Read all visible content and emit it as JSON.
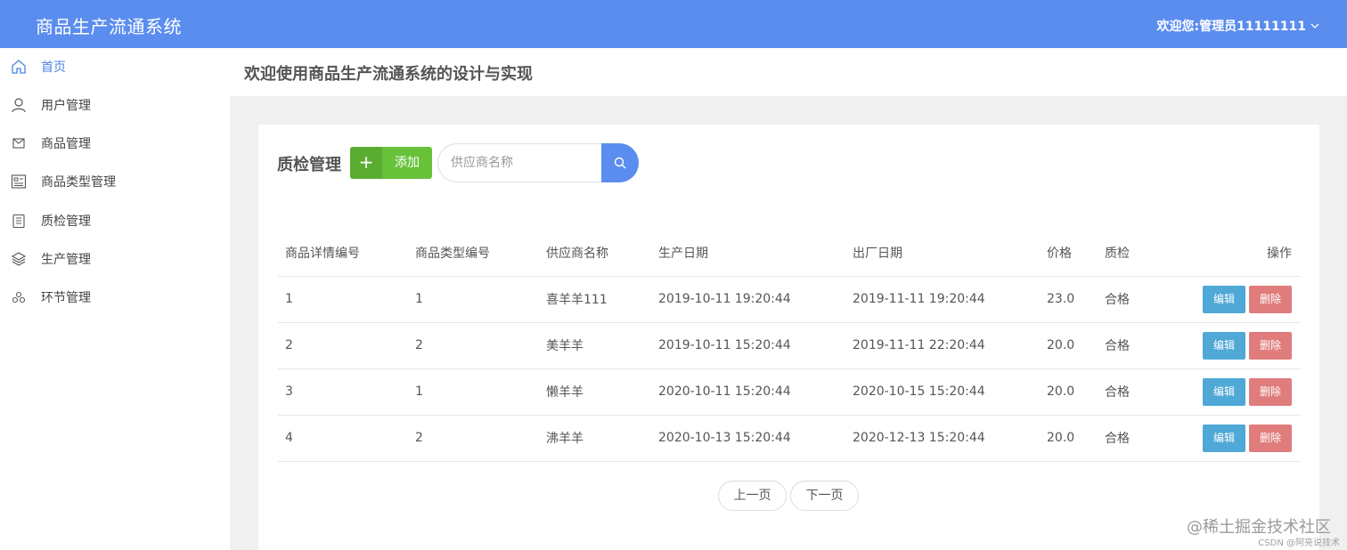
{
  "app": {
    "title": "商品生产流通系统",
    "user_greeting": "欢迎您:管理员11111111"
  },
  "sidebar": {
    "items": [
      {
        "label": "首页",
        "icon": "home-icon",
        "active": true
      },
      {
        "label": "用户管理",
        "icon": "user-icon"
      },
      {
        "label": "商品管理",
        "icon": "mail-icon"
      },
      {
        "label": "商品类型管理",
        "icon": "list-icon"
      },
      {
        "label": "质检管理",
        "icon": "clipboard-icon"
      },
      {
        "label": "生产管理",
        "icon": "layers-icon"
      },
      {
        "label": "环节管理",
        "icon": "cluster-icon"
      }
    ]
  },
  "header": {
    "title": "欢迎使用商品生产流通系统的设计与实现"
  },
  "main": {
    "section_title": "质检管理",
    "add_label": "添加",
    "search_placeholder": "供应商名称",
    "table": {
      "headers": [
        "商品详情编号",
        "商品类型编号",
        "供应商名称",
        "生产日期",
        "出厂日期",
        "价格",
        "质检",
        "操作"
      ],
      "rows": [
        [
          "1",
          "1",
          "喜羊羊111",
          "2019-10-11 19:20:44",
          "2019-11-11 19:20:44",
          "23.0",
          "合格"
        ],
        [
          "2",
          "2",
          "美羊羊",
          "2019-10-11 15:20:44",
          "2019-11-11 22:20:44",
          "20.0",
          "合格"
        ],
        [
          "3",
          "1",
          "懒羊羊",
          "2020-10-11 15:20:44",
          "2020-10-15 15:20:44",
          "20.0",
          "合格"
        ],
        [
          "4",
          "2",
          "沸羊羊",
          "2020-10-13 15:20:44",
          "2020-12-13 15:20:44",
          "20.0",
          "合格"
        ]
      ],
      "edit_label": "编辑",
      "delete_label": "删除"
    },
    "pagination": {
      "prev": "上一页",
      "next": "下一页"
    }
  },
  "watermark": {
    "line1": "@稀土掘金技术社区",
    "line2": "CSDN @阿亮说技术"
  },
  "colors": {
    "topbar": "#5b8def",
    "accent": "#4a84e8",
    "add": "#67c23a",
    "edit": "#4fa8d6",
    "delete": "#e07c7c"
  }
}
